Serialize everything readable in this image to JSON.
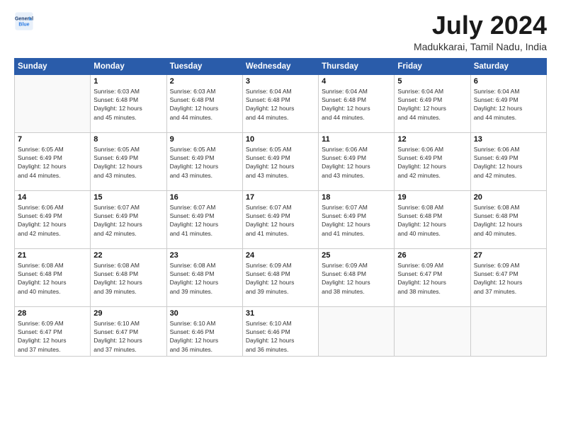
{
  "header": {
    "logo_line1": "General",
    "logo_line2": "Blue",
    "title": "July 2024",
    "subtitle": "Madukkarai, Tamil Nadu, India"
  },
  "days_header": [
    "Sunday",
    "Monday",
    "Tuesday",
    "Wednesday",
    "Thursday",
    "Friday",
    "Saturday"
  ],
  "weeks": [
    [
      {
        "day": "",
        "info": ""
      },
      {
        "day": "1",
        "info": "Sunrise: 6:03 AM\nSunset: 6:48 PM\nDaylight: 12 hours\nand 45 minutes."
      },
      {
        "day": "2",
        "info": "Sunrise: 6:03 AM\nSunset: 6:48 PM\nDaylight: 12 hours\nand 44 minutes."
      },
      {
        "day": "3",
        "info": "Sunrise: 6:04 AM\nSunset: 6:48 PM\nDaylight: 12 hours\nand 44 minutes."
      },
      {
        "day": "4",
        "info": "Sunrise: 6:04 AM\nSunset: 6:48 PM\nDaylight: 12 hours\nand 44 minutes."
      },
      {
        "day": "5",
        "info": "Sunrise: 6:04 AM\nSunset: 6:49 PM\nDaylight: 12 hours\nand 44 minutes."
      },
      {
        "day": "6",
        "info": "Sunrise: 6:04 AM\nSunset: 6:49 PM\nDaylight: 12 hours\nand 44 minutes."
      }
    ],
    [
      {
        "day": "7",
        "info": "Sunrise: 6:05 AM\nSunset: 6:49 PM\nDaylight: 12 hours\nand 44 minutes."
      },
      {
        "day": "8",
        "info": "Sunrise: 6:05 AM\nSunset: 6:49 PM\nDaylight: 12 hours\nand 43 minutes."
      },
      {
        "day": "9",
        "info": "Sunrise: 6:05 AM\nSunset: 6:49 PM\nDaylight: 12 hours\nand 43 minutes."
      },
      {
        "day": "10",
        "info": "Sunrise: 6:05 AM\nSunset: 6:49 PM\nDaylight: 12 hours\nand 43 minutes."
      },
      {
        "day": "11",
        "info": "Sunrise: 6:06 AM\nSunset: 6:49 PM\nDaylight: 12 hours\nand 43 minutes."
      },
      {
        "day": "12",
        "info": "Sunrise: 6:06 AM\nSunset: 6:49 PM\nDaylight: 12 hours\nand 42 minutes."
      },
      {
        "day": "13",
        "info": "Sunrise: 6:06 AM\nSunset: 6:49 PM\nDaylight: 12 hours\nand 42 minutes."
      }
    ],
    [
      {
        "day": "14",
        "info": "Sunrise: 6:06 AM\nSunset: 6:49 PM\nDaylight: 12 hours\nand 42 minutes."
      },
      {
        "day": "15",
        "info": "Sunrise: 6:07 AM\nSunset: 6:49 PM\nDaylight: 12 hours\nand 42 minutes."
      },
      {
        "day": "16",
        "info": "Sunrise: 6:07 AM\nSunset: 6:49 PM\nDaylight: 12 hours\nand 41 minutes."
      },
      {
        "day": "17",
        "info": "Sunrise: 6:07 AM\nSunset: 6:49 PM\nDaylight: 12 hours\nand 41 minutes."
      },
      {
        "day": "18",
        "info": "Sunrise: 6:07 AM\nSunset: 6:49 PM\nDaylight: 12 hours\nand 41 minutes."
      },
      {
        "day": "19",
        "info": "Sunrise: 6:08 AM\nSunset: 6:48 PM\nDaylight: 12 hours\nand 40 minutes."
      },
      {
        "day": "20",
        "info": "Sunrise: 6:08 AM\nSunset: 6:48 PM\nDaylight: 12 hours\nand 40 minutes."
      }
    ],
    [
      {
        "day": "21",
        "info": "Sunrise: 6:08 AM\nSunset: 6:48 PM\nDaylight: 12 hours\nand 40 minutes."
      },
      {
        "day": "22",
        "info": "Sunrise: 6:08 AM\nSunset: 6:48 PM\nDaylight: 12 hours\nand 39 minutes."
      },
      {
        "day": "23",
        "info": "Sunrise: 6:08 AM\nSunset: 6:48 PM\nDaylight: 12 hours\nand 39 minutes."
      },
      {
        "day": "24",
        "info": "Sunrise: 6:09 AM\nSunset: 6:48 PM\nDaylight: 12 hours\nand 39 minutes."
      },
      {
        "day": "25",
        "info": "Sunrise: 6:09 AM\nSunset: 6:48 PM\nDaylight: 12 hours\nand 38 minutes."
      },
      {
        "day": "26",
        "info": "Sunrise: 6:09 AM\nSunset: 6:47 PM\nDaylight: 12 hours\nand 38 minutes."
      },
      {
        "day": "27",
        "info": "Sunrise: 6:09 AM\nSunset: 6:47 PM\nDaylight: 12 hours\nand 37 minutes."
      }
    ],
    [
      {
        "day": "28",
        "info": "Sunrise: 6:09 AM\nSunset: 6:47 PM\nDaylight: 12 hours\nand 37 minutes."
      },
      {
        "day": "29",
        "info": "Sunrise: 6:10 AM\nSunset: 6:47 PM\nDaylight: 12 hours\nand 37 minutes."
      },
      {
        "day": "30",
        "info": "Sunrise: 6:10 AM\nSunset: 6:46 PM\nDaylight: 12 hours\nand 36 minutes."
      },
      {
        "day": "31",
        "info": "Sunrise: 6:10 AM\nSunset: 6:46 PM\nDaylight: 12 hours\nand 36 minutes."
      },
      {
        "day": "",
        "info": ""
      },
      {
        "day": "",
        "info": ""
      },
      {
        "day": "",
        "info": ""
      }
    ]
  ]
}
